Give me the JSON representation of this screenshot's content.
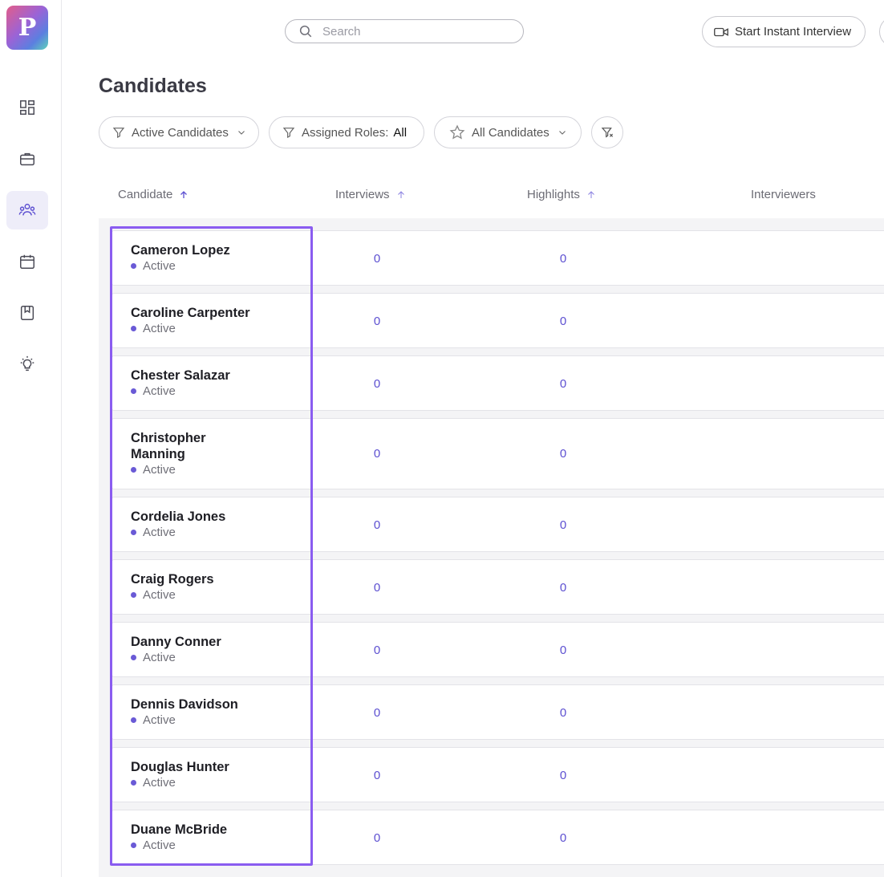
{
  "app": {
    "logo_letter": "P"
  },
  "sidebar": {
    "items": [
      {
        "name": "dashboard",
        "icon": "dashboard-icon"
      },
      {
        "name": "jobs",
        "icon": "briefcase-icon"
      },
      {
        "name": "candidates",
        "icon": "people-icon",
        "active": true
      },
      {
        "name": "calendar",
        "icon": "calendar-icon"
      },
      {
        "name": "bookmarks",
        "icon": "bookmark-icon"
      },
      {
        "name": "insights",
        "icon": "lightbulb-icon"
      }
    ]
  },
  "topbar": {
    "search_placeholder": "Search",
    "instant_interview_label": "Start Instant Interview"
  },
  "page": {
    "title": "Candidates"
  },
  "filters": {
    "active_candidates": "Active Candidates",
    "assigned_roles_label": "Assigned Roles:",
    "assigned_roles_value": "All",
    "all_candidates": "All Candidates"
  },
  "table": {
    "columns": [
      "Candidate",
      "Interviews",
      "Highlights",
      "Interviewers"
    ],
    "rows": [
      {
        "name": "Cameron Lopez",
        "status": "Active",
        "interviews": "0",
        "highlights": "0"
      },
      {
        "name": "Caroline Carpenter",
        "status": "Active",
        "interviews": "0",
        "highlights": "0"
      },
      {
        "name": "Chester Salazar",
        "status": "Active",
        "interviews": "0",
        "highlights": "0"
      },
      {
        "name": "Christopher Manning",
        "status": "Active",
        "interviews": "0",
        "highlights": "0"
      },
      {
        "name": "Cordelia Jones",
        "status": "Active",
        "interviews": "0",
        "highlights": "0"
      },
      {
        "name": "Craig Rogers",
        "status": "Active",
        "interviews": "0",
        "highlights": "0"
      },
      {
        "name": "Danny Conner",
        "status": "Active",
        "interviews": "0",
        "highlights": "0"
      },
      {
        "name": "Dennis Davidson",
        "status": "Active",
        "interviews": "0",
        "highlights": "0"
      },
      {
        "name": "Douglas Hunter",
        "status": "Active",
        "interviews": "0",
        "highlights": "0"
      },
      {
        "name": "Duane McBride",
        "status": "Active",
        "interviews": "0",
        "highlights": "0"
      }
    ]
  },
  "colors": {
    "accent": "#5c4fd1",
    "highlight_box": "#8a5cf0",
    "status_dot": "#6a5ad6"
  }
}
